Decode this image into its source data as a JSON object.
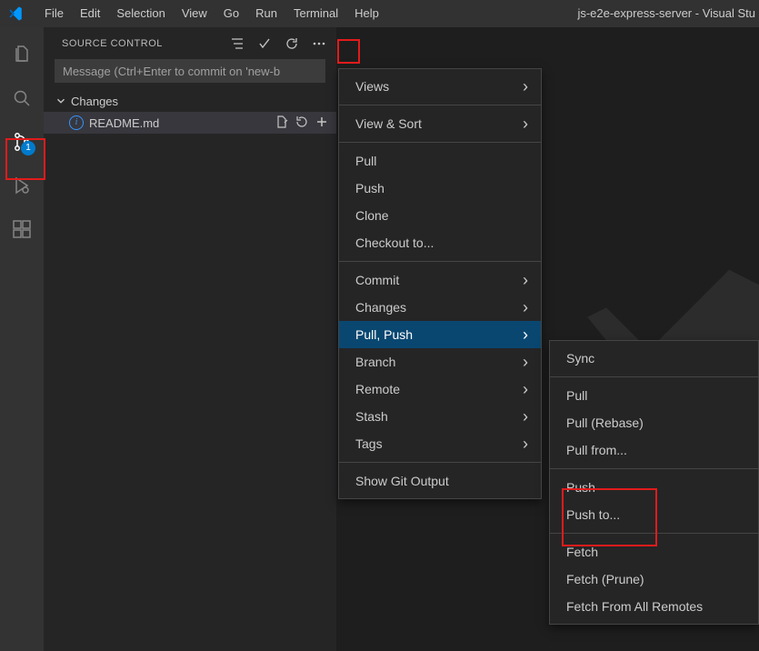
{
  "menubar": {
    "items": [
      "File",
      "Edit",
      "Selection",
      "View",
      "Go",
      "Run",
      "Terminal",
      "Help"
    ],
    "title": "js-e2e-express-server - Visual Stu"
  },
  "activitybar": {
    "scm_badge": "1"
  },
  "sidebar": {
    "title": "SOURCE CONTROL",
    "commit_placeholder": "Message (Ctrl+Enter to commit on 'new-b",
    "changes_label": "Changes",
    "file_name": "README.md"
  },
  "menu_main": {
    "items": [
      {
        "label": "Views",
        "hassub": true
      },
      {
        "sep": true
      },
      {
        "label": "View & Sort",
        "hassub": true
      },
      {
        "sep": true
      },
      {
        "label": "Pull"
      },
      {
        "label": "Push"
      },
      {
        "label": "Clone"
      },
      {
        "label": "Checkout to..."
      },
      {
        "sep": true
      },
      {
        "label": "Commit",
        "hassub": true
      },
      {
        "label": "Changes",
        "hassub": true
      },
      {
        "label": "Pull, Push",
        "hassub": true,
        "selected": true
      },
      {
        "label": "Branch",
        "hassub": true
      },
      {
        "label": "Remote",
        "hassub": true
      },
      {
        "label": "Stash",
        "hassub": true
      },
      {
        "label": "Tags",
        "hassub": true
      },
      {
        "sep": true
      },
      {
        "label": "Show Git Output"
      }
    ]
  },
  "menu_sub": {
    "items": [
      {
        "label": "Sync"
      },
      {
        "sep": true
      },
      {
        "label": "Pull"
      },
      {
        "label": "Pull (Rebase)"
      },
      {
        "label": "Pull from..."
      },
      {
        "sep": true
      },
      {
        "label": "Push",
        "highlight": true
      },
      {
        "label": "Push to...",
        "highlight": true
      },
      {
        "sep": true
      },
      {
        "label": "Fetch"
      },
      {
        "label": "Fetch (Prune)"
      },
      {
        "label": "Fetch From All Remotes"
      }
    ]
  }
}
